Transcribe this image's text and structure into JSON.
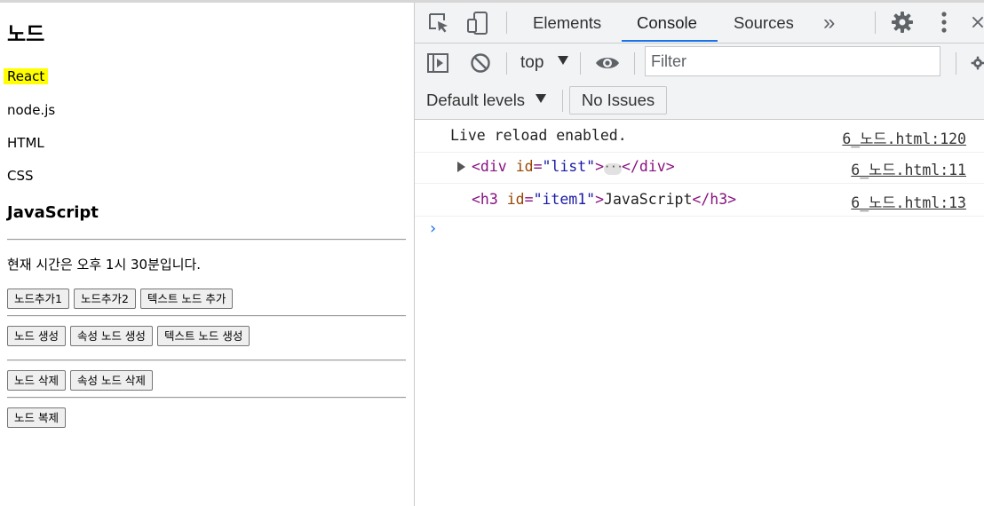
{
  "page": {
    "title": "노드",
    "items": [
      "React",
      "node.js",
      "HTML",
      "CSS"
    ],
    "subheading": "JavaScript",
    "time_text": "현재 시간은 오후 1시 30분입니다.",
    "buttons_row1": [
      "노드추가1",
      "노드추가2",
      "텍스트 노드 추가"
    ],
    "buttons_row2": [
      "노드 생성",
      "속성 노드 생성",
      "텍스트 노드 생성"
    ],
    "buttons_row3": [
      "노드 삭제",
      "속성 노드 삭제"
    ],
    "buttons_row4": [
      "노드 복제"
    ],
    "highlight_color": "#ffff00"
  },
  "devtools": {
    "tabs": [
      "Elements",
      "Console",
      "Sources"
    ],
    "active_tab": "Console",
    "more_tabs_glyph": "»",
    "context": "top",
    "filter_placeholder": "Filter",
    "levels": "Default levels",
    "issues": "No Issues",
    "accent": "#1a73e8",
    "icons": [
      "inspect-icon",
      "device-toolbar-icon",
      "gear-icon",
      "kebab-menu-icon",
      "close-icon",
      "sidebar-icon",
      "clear-console-icon",
      "eye-icon"
    ],
    "logs": [
      {
        "message": "Live reload enabled.",
        "source": "6_노드.html:120"
      },
      {
        "open": "<div",
        "attr": "id",
        "value": "\"list\"",
        "close": ">",
        "end_tag": "</div>",
        "source": "6_노드.html:11"
      },
      {
        "open": "<h3",
        "attr": "id",
        "value": "\"item1\"",
        "close": ">",
        "text": "JavaScript",
        "end_tag": "</h3>",
        "source": "6_노드.html:13"
      }
    ],
    "prompt_glyph": "›"
  }
}
